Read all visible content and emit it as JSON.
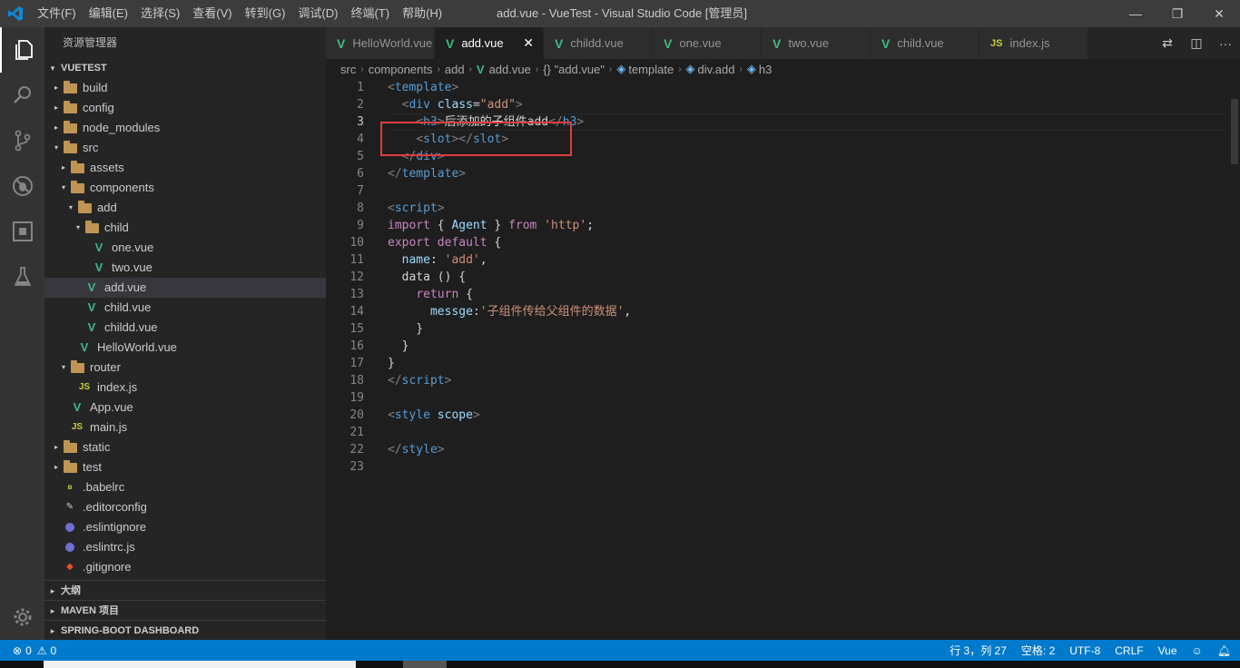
{
  "window": {
    "title": "add.vue - VueTest - Visual Studio Code [管理员]"
  },
  "menu": [
    "文件(F)",
    "编辑(E)",
    "选择(S)",
    "查看(V)",
    "转到(G)",
    "调试(D)",
    "终端(T)",
    "帮助(H)"
  ],
  "activity": [
    "explorer-icon",
    "search-icon",
    "source-control-icon",
    "debug-icon",
    "extensions-icon",
    "test-flask-icon",
    "settings-gear-icon"
  ],
  "sidebar": {
    "header": "资源管理器",
    "root": "VUETEST",
    "tree": [
      {
        "label": "build",
        "depth": 1,
        "twisty": "▸",
        "icon": "folder"
      },
      {
        "label": "config",
        "depth": 1,
        "twisty": "▸",
        "icon": "folder"
      },
      {
        "label": "node_modules",
        "depth": 1,
        "twisty": "▸",
        "icon": "folder"
      },
      {
        "label": "src",
        "depth": 1,
        "twisty": "▾",
        "icon": "folder"
      },
      {
        "label": "assets",
        "depth": 2,
        "twisty": "▸",
        "icon": "folder"
      },
      {
        "label": "components",
        "depth": 2,
        "twisty": "▾",
        "icon": "folder"
      },
      {
        "label": "add",
        "depth": 3,
        "twisty": "▾",
        "icon": "folder"
      },
      {
        "label": "child",
        "depth": 4,
        "twisty": "▾",
        "icon": "folder"
      },
      {
        "label": "one.vue",
        "depth": 5,
        "twisty": "",
        "icon": "vue"
      },
      {
        "label": "two.vue",
        "depth": 5,
        "twisty": "",
        "icon": "vue"
      },
      {
        "label": "add.vue",
        "depth": 4,
        "twisty": "",
        "icon": "vue",
        "selected": true
      },
      {
        "label": "child.vue",
        "depth": 4,
        "twisty": "",
        "icon": "vue"
      },
      {
        "label": "childd.vue",
        "depth": 4,
        "twisty": "",
        "icon": "vue"
      },
      {
        "label": "HelloWorld.vue",
        "depth": 3,
        "twisty": "",
        "icon": "vue"
      },
      {
        "label": "router",
        "depth": 2,
        "twisty": "▾",
        "icon": "folder"
      },
      {
        "label": "index.js",
        "depth": 3,
        "twisty": "",
        "icon": "js"
      },
      {
        "label": "App.vue",
        "depth": 2,
        "twisty": "",
        "icon": "vue"
      },
      {
        "label": "main.js",
        "depth": 2,
        "twisty": "",
        "icon": "js"
      },
      {
        "label": "static",
        "depth": 1,
        "twisty": "▸",
        "icon": "folder"
      },
      {
        "label": "test",
        "depth": 1,
        "twisty": "▸",
        "icon": "folder"
      },
      {
        "label": ".babelrc",
        "depth": 1,
        "twisty": "",
        "icon": "babel"
      },
      {
        "label": ".editorconfig",
        "depth": 1,
        "twisty": "",
        "icon": "editorconfig"
      },
      {
        "label": ".eslintignore",
        "depth": 1,
        "twisty": "",
        "icon": "eslint"
      },
      {
        "label": ".eslintrc.js",
        "depth": 1,
        "twisty": "",
        "icon": "eslint"
      },
      {
        "label": ".gitignore",
        "depth": 1,
        "twisty": "",
        "icon": "git"
      }
    ],
    "sections": [
      "大纲",
      "MAVEN 项目",
      "SPRING-BOOT DASHBOARD"
    ]
  },
  "tabs": [
    {
      "label": "HelloWorld.vue",
      "type": "vue"
    },
    {
      "label": "add.vue",
      "type": "vue",
      "active": true
    },
    {
      "label": "childd.vue",
      "type": "vue"
    },
    {
      "label": "one.vue",
      "type": "vue"
    },
    {
      "label": "two.vue",
      "type": "vue"
    },
    {
      "label": "child.vue",
      "type": "vue"
    },
    {
      "label": "index.js",
      "type": "js"
    }
  ],
  "breadcrumbs": [
    "src",
    "components",
    "add",
    "add.vue",
    "{} \"add.vue\"",
    "template",
    "div.add",
    "h3"
  ],
  "code": [
    [
      [
        "tg",
        "<"
      ],
      [
        "t",
        "template"
      ],
      [
        "tg",
        ">"
      ]
    ],
    [
      [
        "pl",
        "  "
      ],
      [
        "tg",
        "<"
      ],
      [
        "t",
        "div "
      ],
      [
        "at",
        "class"
      ],
      [
        "pl",
        "="
      ],
      [
        "st",
        "\"add\""
      ],
      [
        "tg",
        ">"
      ]
    ],
    [
      [
        "pl",
        "    "
      ],
      [
        "tg",
        "<"
      ],
      [
        "t",
        "h3"
      ],
      [
        "tg",
        ">"
      ],
      [
        "pl",
        "后添加的子组件add"
      ],
      [
        "tg",
        "</"
      ],
      [
        "t",
        "h3"
      ],
      [
        "tg",
        ">"
      ]
    ],
    [
      [
        "pl",
        "    "
      ],
      [
        "tg",
        "<"
      ],
      [
        "t",
        "slot"
      ],
      [
        "tg",
        "></"
      ],
      [
        "t",
        "slot"
      ],
      [
        "tg",
        ">"
      ]
    ],
    [
      [
        "pl",
        "  "
      ],
      [
        "tg",
        "</"
      ],
      [
        "t",
        "div"
      ],
      [
        "tg",
        ">"
      ]
    ],
    [
      [
        "tg",
        "</"
      ],
      [
        "t",
        "template"
      ],
      [
        "tg",
        ">"
      ]
    ],
    [],
    [
      [
        "tg",
        "<"
      ],
      [
        "t",
        "script"
      ],
      [
        "tg",
        ">"
      ]
    ],
    [
      [
        "kw",
        "import"
      ],
      [
        "pl",
        " { "
      ],
      [
        "vr",
        "Agent"
      ],
      [
        "pl",
        " } "
      ],
      [
        "kw",
        "from"
      ],
      [
        "pl",
        " "
      ],
      [
        "st",
        "'http'"
      ],
      [
        "pl",
        ";"
      ]
    ],
    [
      [
        "kw",
        "export"
      ],
      [
        "pl",
        " "
      ],
      [
        "kw",
        "default"
      ],
      [
        "pl",
        " {"
      ]
    ],
    [
      [
        "pl",
        "  "
      ],
      [
        "vr",
        "name"
      ],
      [
        "pl",
        ": "
      ],
      [
        "st",
        "'add'"
      ],
      [
        "pl",
        ","
      ]
    ],
    [
      [
        "pl",
        "  data () {"
      ]
    ],
    [
      [
        "pl",
        "    "
      ],
      [
        "kw",
        "return"
      ],
      [
        "pl",
        " {"
      ]
    ],
    [
      [
        "pl",
        "      "
      ],
      [
        "vr",
        "messge"
      ],
      [
        "pl",
        ":"
      ],
      [
        "st",
        "'子组件传给父组件的数据'"
      ],
      [
        "pl",
        ","
      ]
    ],
    [
      [
        "pl",
        "    }"
      ]
    ],
    [
      [
        "pl",
        "  }"
      ]
    ],
    [
      [
        "pl",
        "}"
      ]
    ],
    [
      [
        "tg",
        "</"
      ],
      [
        "t",
        "script"
      ],
      [
        "tg",
        ">"
      ]
    ],
    [],
    [
      [
        "tg",
        "<"
      ],
      [
        "t",
        "style "
      ],
      [
        "at",
        "scope"
      ],
      [
        "tg",
        ">"
      ]
    ],
    [],
    [
      [
        "tg",
        "</"
      ],
      [
        "t",
        "style"
      ],
      [
        "tg",
        ">"
      ]
    ],
    []
  ],
  "status": {
    "errors": "0",
    "warnings": "0",
    "position": "行 3，列 27",
    "spaces": "空格: 2",
    "encoding": "UTF-8",
    "eol": "CRLF",
    "language": "Vue"
  }
}
